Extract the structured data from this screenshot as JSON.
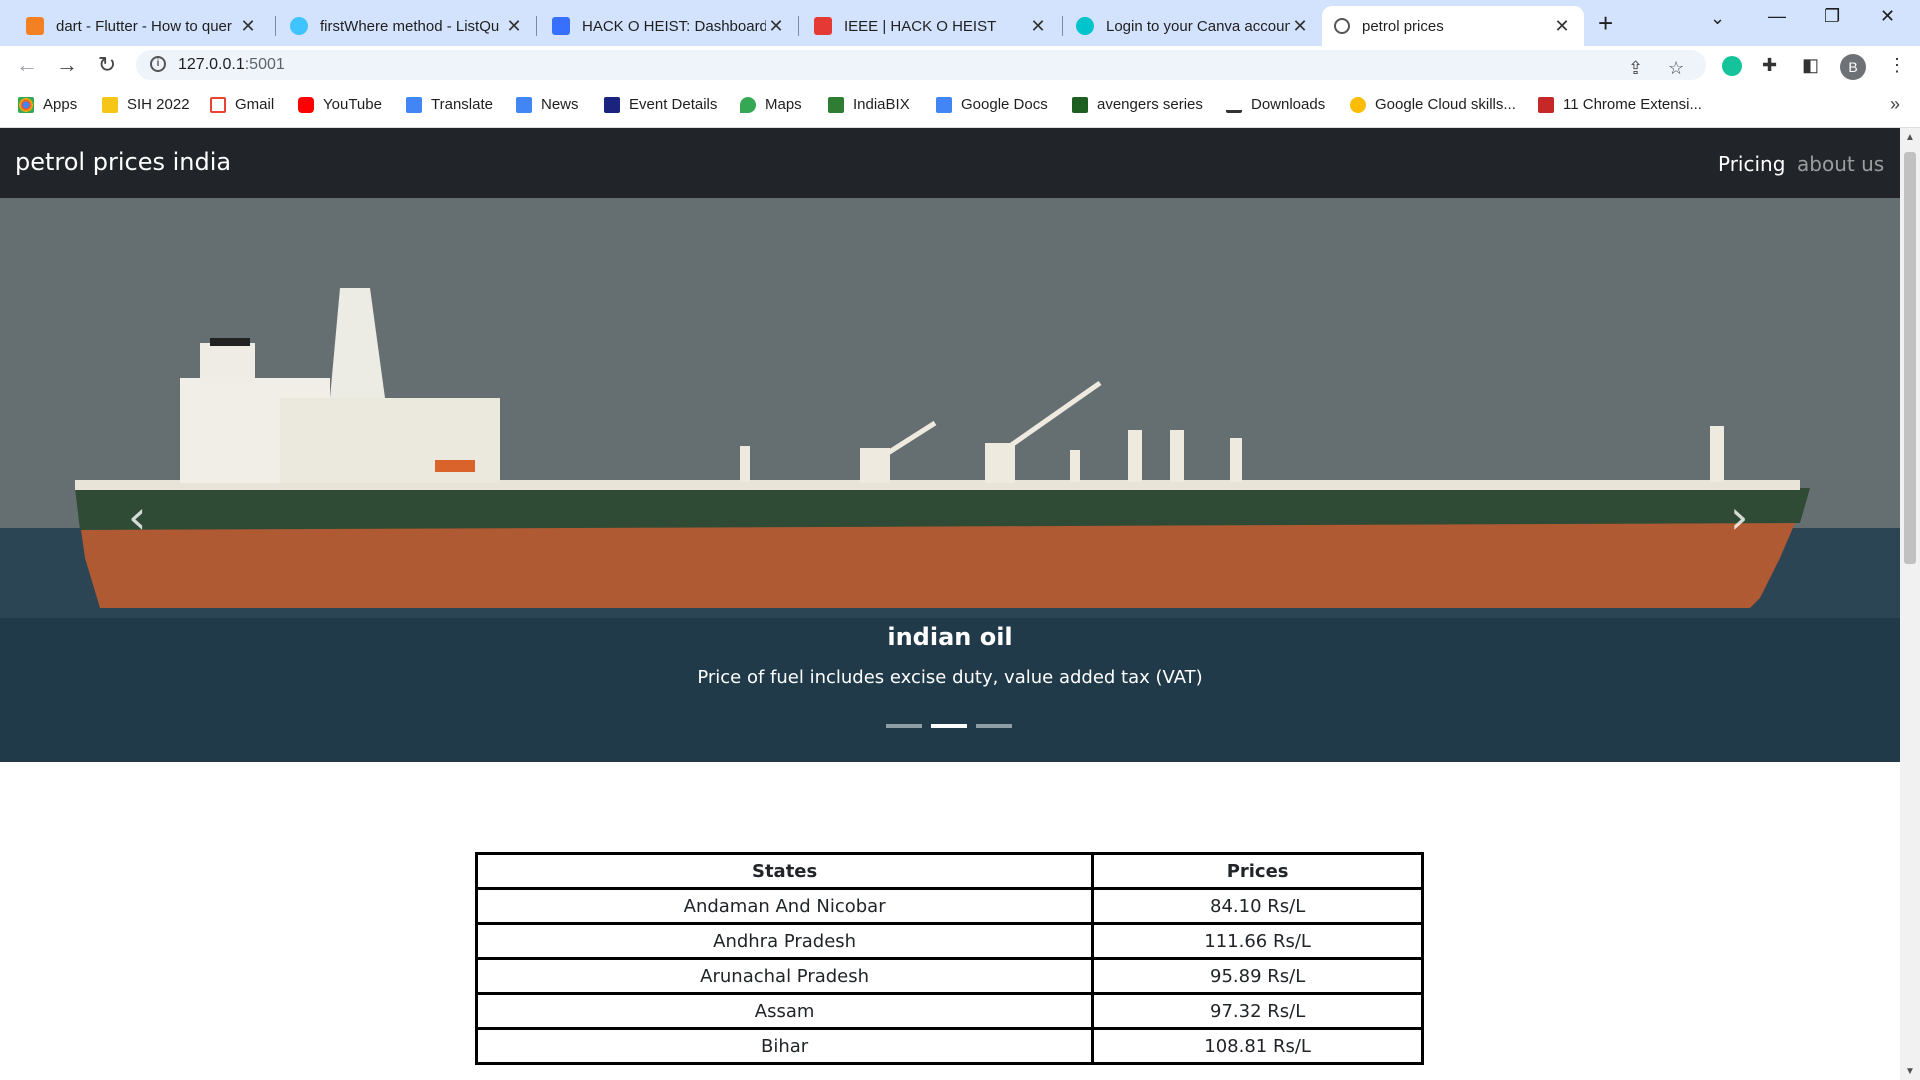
{
  "browser": {
    "tabs": [
      {
        "title": "dart - Flutter - How to quer",
        "favicon": "stackoverflow-icon"
      },
      {
        "title": "firstWhere method - ListQu",
        "favicon": "dart-icon"
      },
      {
        "title": "HACK O HEIST: Dashboard |",
        "favicon": "devfolio-icon"
      },
      {
        "title": "IEEE | HACK O HEIST",
        "favicon": "ieee-icon"
      },
      {
        "title": "Login to your Canva accoun",
        "favicon": "canva-icon"
      },
      {
        "title": "petrol prices",
        "favicon": "globe-icon",
        "active": true
      }
    ],
    "url_host": "127.0.0.1",
    "url_port": ":5001",
    "profile_initial": "B",
    "bookmarks": [
      {
        "label": "Apps",
        "icon": "apps-grid-icon",
        "color": "#4285f4"
      },
      {
        "label": "SIH 2022",
        "icon": "folder-icon",
        "color": "#f5c518"
      },
      {
        "label": "Gmail",
        "icon": "gmail-icon",
        "color": "#ea4335"
      },
      {
        "label": "YouTube",
        "icon": "youtube-icon",
        "color": "#ff0000"
      },
      {
        "label": "Translate",
        "icon": "translate-icon",
        "color": "#4285f4"
      },
      {
        "label": "News",
        "icon": "news-icon",
        "color": "#4285f4"
      },
      {
        "label": "Event Details",
        "icon": "event-icon",
        "color": "#1a237e"
      },
      {
        "label": "Maps",
        "icon": "maps-icon",
        "color": "#34a853"
      },
      {
        "label": "IndiaBIX",
        "icon": "indiabix-icon",
        "color": "#2e7d32"
      },
      {
        "label": "Google Docs",
        "icon": "docs-icon",
        "color": "#4285f4"
      },
      {
        "label": "avengers series",
        "icon": "bookmark-c-icon",
        "color": "#1b5e20"
      },
      {
        "label": "Downloads",
        "icon": "download-icon",
        "color": "#333333"
      },
      {
        "label": "Google Cloud skills...",
        "icon": "cloud-icon",
        "color": "#fbbc04"
      },
      {
        "label": "11 Chrome Extensi...",
        "icon": "extension-site-icon",
        "color": "#c62828"
      }
    ]
  },
  "site": {
    "brand": "petrol prices india",
    "nav": [
      {
        "label": "Pricing",
        "active": true
      },
      {
        "label": "about us",
        "active": false
      }
    ]
  },
  "carousel": {
    "title": "indian oil",
    "text": "Price of fuel includes excise duty, value added tax (VAT)",
    "slide_count": 3,
    "active_index": 1
  },
  "prices_table": {
    "headers": [
      "States",
      "Prices"
    ],
    "rows": [
      [
        "Andaman And Nicobar",
        "84.10 Rs/L"
      ],
      [
        "Andhra Pradesh",
        "111.66 Rs/L"
      ],
      [
        "Arunachal Pradesh",
        "95.89 Rs/L"
      ],
      [
        "Assam",
        "97.32 Rs/L"
      ],
      [
        "Bihar",
        "108.81 Rs/L"
      ]
    ]
  }
}
